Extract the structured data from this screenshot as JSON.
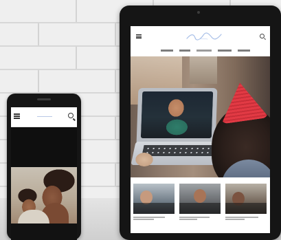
{
  "scene": {
    "devices": [
      {
        "kind": "phone",
        "header": {
          "menu_icon": "menu-icon",
          "search_icon": "search-icon"
        }
      },
      {
        "kind": "tablet",
        "header": {
          "menu_icon": "menu-icon",
          "search_icon": "search-icon"
        },
        "nav": {
          "item_count": 5,
          "active_index": 2
        },
        "thumbnails": {
          "count": 3
        }
      }
    ]
  }
}
